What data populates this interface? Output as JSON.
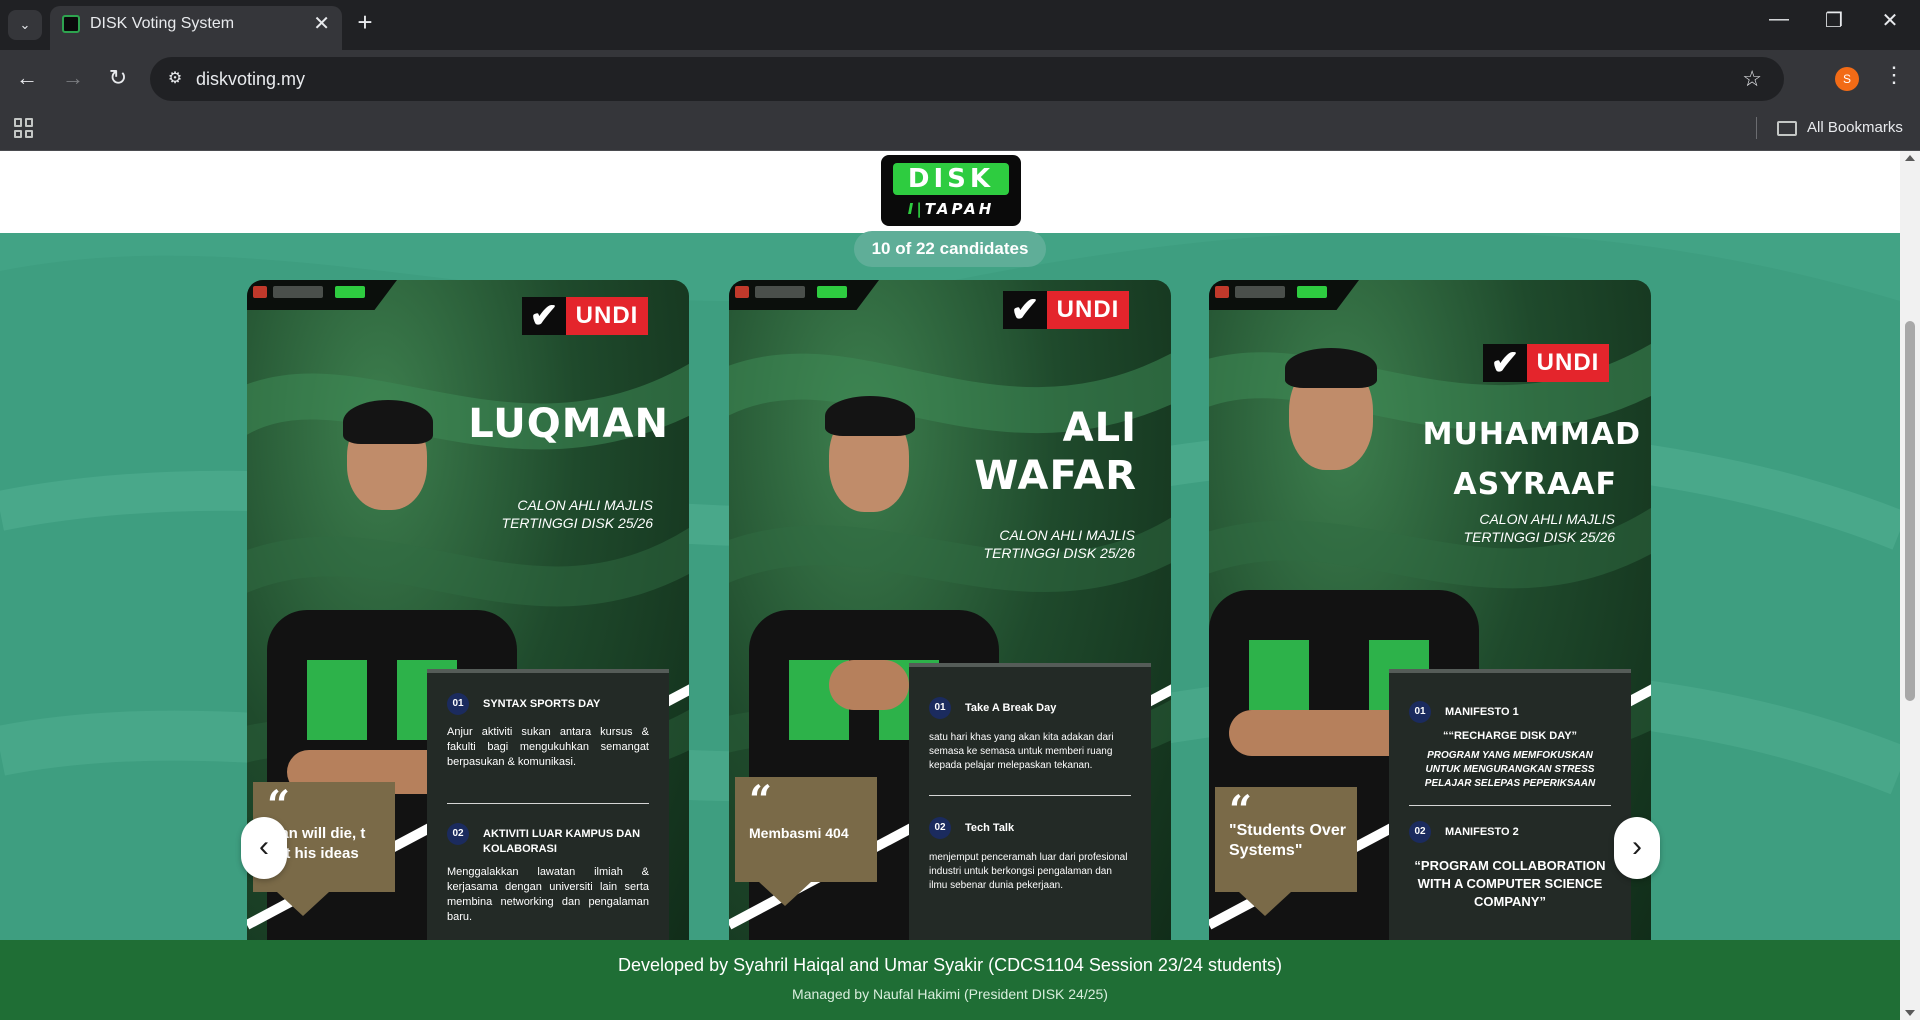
{
  "browser": {
    "tab_title": "DISK Voting System",
    "tab_close": "✕",
    "new_tab": "+",
    "url": "diskvoting.my",
    "profile_initial": "S",
    "bookmarks_label": "All Bookmarks",
    "window": {
      "minimize": "—",
      "restore": "❐",
      "close": "✕"
    },
    "nav": {
      "back": "←",
      "forward": "→",
      "reload": "↻"
    },
    "star": "☆",
    "menu": "⋮",
    "site_info": "⚙",
    "tab_search": "⌄"
  },
  "header": {
    "logo_top": "DISK",
    "logo_bottom_bars": "I|",
    "logo_bottom": "TAPAH"
  },
  "carousel": {
    "count_label": "10 of 22 candidates",
    "prev_label": "‹",
    "next_label": "›",
    "cards": [
      {
        "undi": "UNDI",
        "check": "✔",
        "name_line1": "LUQMAN",
        "name_line2": "",
        "role_line1": "CALON AHLI MAJLIS",
        "role_line2": "TERTINGGI  DISK 25/26",
        "quote_mark": "“",
        "quote": "man will die, t not his ideas",
        "manifesto": [
          {
            "num": "01",
            "title": "SYNTAX SPORTS DAY",
            "desc": "Anjur aktiviti sukan antara kursus & fakulti bagi mengukuhkan semangat berpasukan & komunikasi."
          },
          {
            "num": "02",
            "title": "AKTIVITI LUAR KAMPUS DAN KOLABORASI",
            "desc": "Menggalakkan lawatan ilmiah & kerjasama dengan universiti lain serta membina networking dan pengalaman baru."
          }
        ]
      },
      {
        "undi": "UNDI",
        "check": "✔",
        "name_line1": "ALI",
        "name_line2": "WAFAR",
        "role_line1": "CALON AHLI MAJLIS",
        "role_line2": "TERTINGGI  DISK 25/26",
        "quote_mark": "“",
        "quote": "Membasmi 404",
        "manifesto": [
          {
            "num": "01",
            "title": "Take A Break Day",
            "desc": "satu hari khas yang akan kita adakan dari semasa ke semasa untuk memberi ruang kepada pelajar melepaskan tekanan."
          },
          {
            "num": "02",
            "title": "Tech Talk",
            "desc": "menjemput penceramah luar dari profesional industri untuk berkongsi pengalaman dan ilmu sebenar dunia pekerjaan."
          }
        ]
      },
      {
        "undi": "UNDI",
        "check": "✔",
        "name_line1": "MUHAMMAD",
        "name_line2": "ASYRAAF",
        "role_line1": "CALON AHLI MAJLIS",
        "role_line2": "TERTINGGI  DISK 25/26",
        "quote_mark": "“",
        "quote": "\"Students Over Systems\"",
        "manifesto": [
          {
            "num": "01",
            "title": "MANIFESTO 1",
            "desc_head": "““RECHARGE DISK DAY”",
            "desc": "PROGRAM YANG MEMFOKUSKAN UNTUK MENGURANGKAN STRESS PELAJAR SELEPAS PEPERIKSAAN"
          },
          {
            "num": "02",
            "title": "MANIFESTO 2",
            "desc": "“PROGRAM COLLABORATION WITH A COMPUTER SCIENCE COMPANY”"
          }
        ]
      }
    ]
  },
  "footer": {
    "developed_by": "Developed by Syahril Haiqal and Umar Syakir (CDCS1104 Session 23/24 students)",
    "managed_by": "Managed by Naufal Hakimi (President DISK 24/25)"
  },
  "colors": {
    "page_bg": "#3e9e80",
    "footer_bg": "#1f6e35",
    "undi_red": "#e4252c",
    "quote_box": "#7a6a48",
    "manifesto_bg": "#232a26",
    "logo_green": "#2ecc40"
  }
}
